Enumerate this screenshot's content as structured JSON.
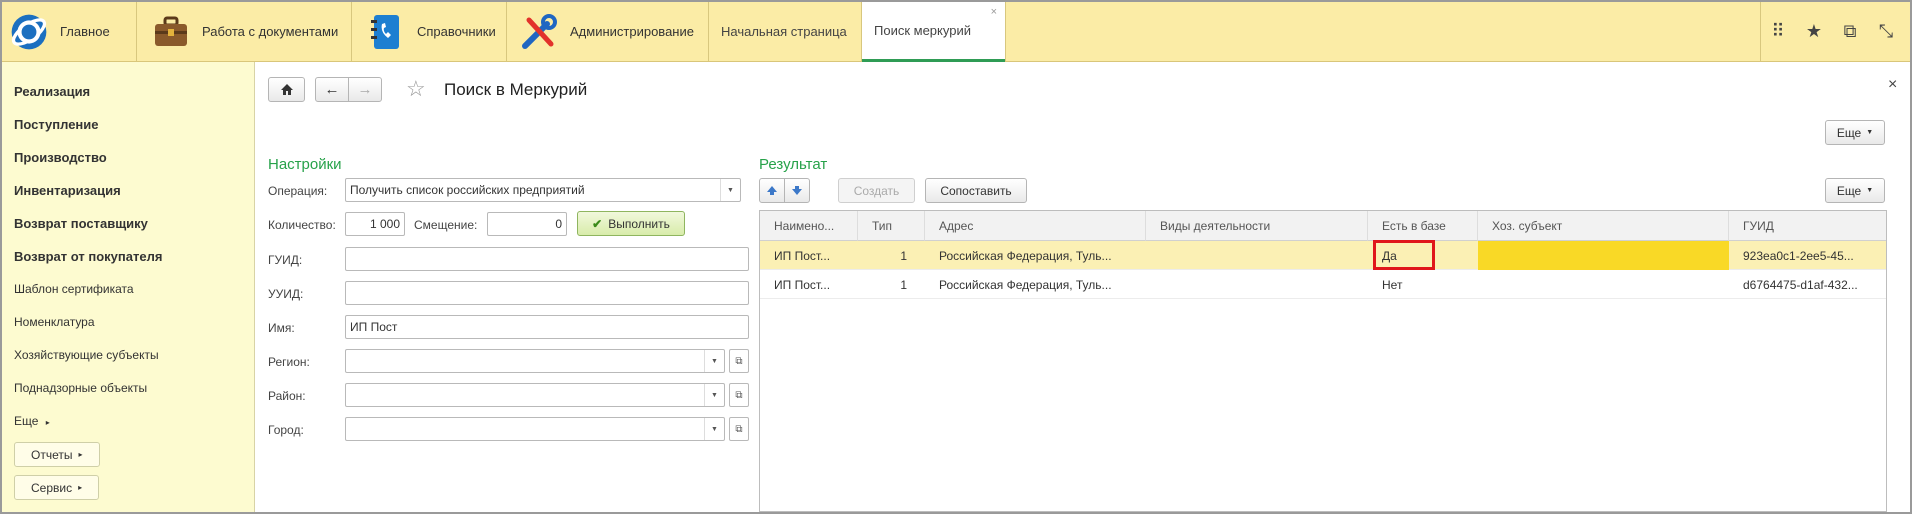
{
  "topbar": {
    "sections": [
      {
        "label": "Главное",
        "icon": "app-logo-icon"
      },
      {
        "label": "Работа с документами",
        "icon": "briefcase-icon"
      },
      {
        "label": "Справочники",
        "icon": "phonebook-icon"
      },
      {
        "label": "Администрирование",
        "icon": "tools-icon"
      }
    ],
    "tabs": [
      {
        "label": "Начальная страница"
      },
      {
        "label": "Поиск меркурий",
        "close": "×"
      }
    ],
    "right_icons": [
      "⠿",
      "★",
      "⧉",
      "⤡"
    ]
  },
  "sidebar": {
    "items_bold": [
      "Реализация",
      "Поступление",
      "Производство",
      "Инвентаризация",
      "Возврат поставщику",
      "Возврат от покупателя"
    ],
    "items": [
      "Шаблон сертификата",
      "Номенклатура",
      "Хозяйствующие субъекты",
      "Поднадзорные объекты"
    ],
    "more": "Еще",
    "buttons": [
      "Отчеты",
      "Сервис"
    ]
  },
  "form": {
    "title": "Поиск в Меркурий",
    "more": "Еще",
    "close": "×",
    "settings_header": "Настройки",
    "result_header": "Результат",
    "operation_label": "Операция:",
    "operation_value": "Получить список российских предприятий",
    "quantity_label": "Количество:",
    "quantity_value": "1 000",
    "offset_label": "Смещение:",
    "offset_value": "0",
    "execute_label": "Выполнить",
    "guid_label": "ГУИД:",
    "uuid_label": "УУИД:",
    "name_label": "Имя:",
    "name_value": "ИП Пост",
    "region_label": "Регион:",
    "district_label": "Район:",
    "city_label": "Город:",
    "create_label": "Создать",
    "match_label": "Сопоставить",
    "grid_more": "Еще"
  },
  "table": {
    "columns": [
      "Наимено...",
      "Тип",
      "Адрес",
      "Виды деятельности",
      "Есть в базе",
      "Хоз. субъект",
      "ГУИД"
    ],
    "rows": [
      {
        "name": "ИП Пост...",
        "type": "1",
        "address": "Российская Федерация, Туль...",
        "activity": "",
        "in_base": "Да",
        "entity": "",
        "guid": "923ea0c1-2ee5-45...",
        "selected": true
      },
      {
        "name": "ИП Пост...",
        "type": "1",
        "address": "Российская Федерация, Туль...",
        "activity": "",
        "in_base": "Нет",
        "entity": "",
        "guid": "d6764475-d1af-432...",
        "selected": false
      }
    ]
  },
  "colors": {
    "accent_green": "#27a24a",
    "topbar_bg": "#fbeca6",
    "sidebar_bg": "#fdfbd0",
    "selected_row": "#fbf0b4",
    "entity_cell": "#f9d926",
    "highlight": "#e0161b"
  }
}
